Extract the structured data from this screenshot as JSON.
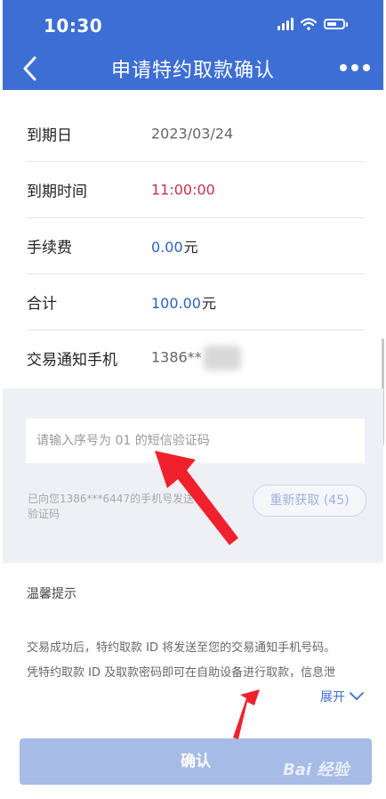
{
  "status_bar": {
    "time": "10:30"
  },
  "header": {
    "title": "申请特约取款确认"
  },
  "rows": [
    {
      "label": "到期日",
      "value": "2023/03/24"
    },
    {
      "label": "到期时间",
      "value": "11:00:00"
    },
    {
      "label": "手续费",
      "value": "0.00",
      "unit": "元"
    },
    {
      "label": "合计",
      "value": "100.00",
      "unit": "元"
    },
    {
      "label": "交易通知手机",
      "value": "1386**"
    }
  ],
  "sms": {
    "placeholder": "请输入序号为 01 的短信验证码",
    "hint": "已向您1386***6447的手机号发送验证码",
    "resend_label": "重新获取 (45)"
  },
  "tips": {
    "title": "温馨提示",
    "line1": "交易成功后，特约取款 ID 将发送至您的交易通知手机号码。",
    "line2": "凭特约取款 ID 及取款密码即可在自助设备进行取款，信息泄",
    "expand_label": "展开"
  },
  "confirm_label": "确认",
  "watermark": "Bai 经验",
  "colors": {
    "primary": "#3d6ed3",
    "accent_red": "#c7324a",
    "value_blue": "#2f5fc0",
    "annotation_red": "#f0212d"
  }
}
